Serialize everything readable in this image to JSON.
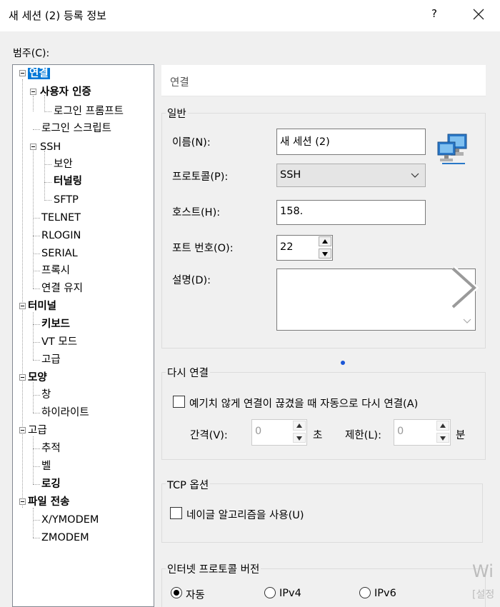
{
  "window": {
    "title": "새 세션 (2) 등록 정보",
    "help": "?"
  },
  "category_label": "범주(C):",
  "tree": [
    {
      "label": "연결"
    },
    {
      "label": "사용자 인증"
    },
    {
      "label": "로그인 프롬프트"
    },
    {
      "label": "로그인 스크립트"
    },
    {
      "label": "SSH"
    },
    {
      "label": "보안"
    },
    {
      "label": "터널링"
    },
    {
      "label": "SFTP"
    },
    {
      "label": "TELNET"
    },
    {
      "label": "RLOGIN"
    },
    {
      "label": "SERIAL"
    },
    {
      "label": "프록시"
    },
    {
      "label": "연결 유지"
    },
    {
      "label": "터미널"
    },
    {
      "label": "키보드"
    },
    {
      "label": "VT 모드"
    },
    {
      "label": "고급"
    },
    {
      "label": "모양"
    },
    {
      "label": "창"
    },
    {
      "label": "하이라이트"
    },
    {
      "label": "고급"
    },
    {
      "label": "추적"
    },
    {
      "label": "벨"
    },
    {
      "label": "로깅"
    },
    {
      "label": "파일 전송"
    },
    {
      "label": "X/YMODEM"
    },
    {
      "label": "ZMODEM"
    }
  ],
  "panel": {
    "header": "연결",
    "general": {
      "title": "일반",
      "name_label": "이름(N):",
      "name_value": "새 세션 (2)",
      "protocol_label": "프로토콜(P):",
      "protocol_value": "SSH",
      "host_label": "호스트(H):",
      "host_value": "158.",
      "port_label": "포트 번호(O):",
      "port_value": "22",
      "desc_label": "설명(D):",
      "desc_value": ""
    },
    "reconnect": {
      "title": "다시 연결",
      "checkbox_label": "예기치 않게 연결이 끊겼을 때 자동으로 다시 연결(A)",
      "interval_label": "간격(V):",
      "interval_value": "0",
      "interval_unit": "초",
      "limit_label": "제한(L):",
      "limit_value": "0",
      "limit_unit": "분"
    },
    "tcp": {
      "title": "TCP 옵션",
      "checkbox_label": "네이글 알고리즘을 사용(U)"
    },
    "ip": {
      "title": "인터넷 프로토콜 버전",
      "options": [
        "자동",
        "IPv4",
        "IPv6"
      ],
      "selected": "자동"
    }
  },
  "watermark": {
    "line1": "Wi",
    "line2": "[설정"
  }
}
